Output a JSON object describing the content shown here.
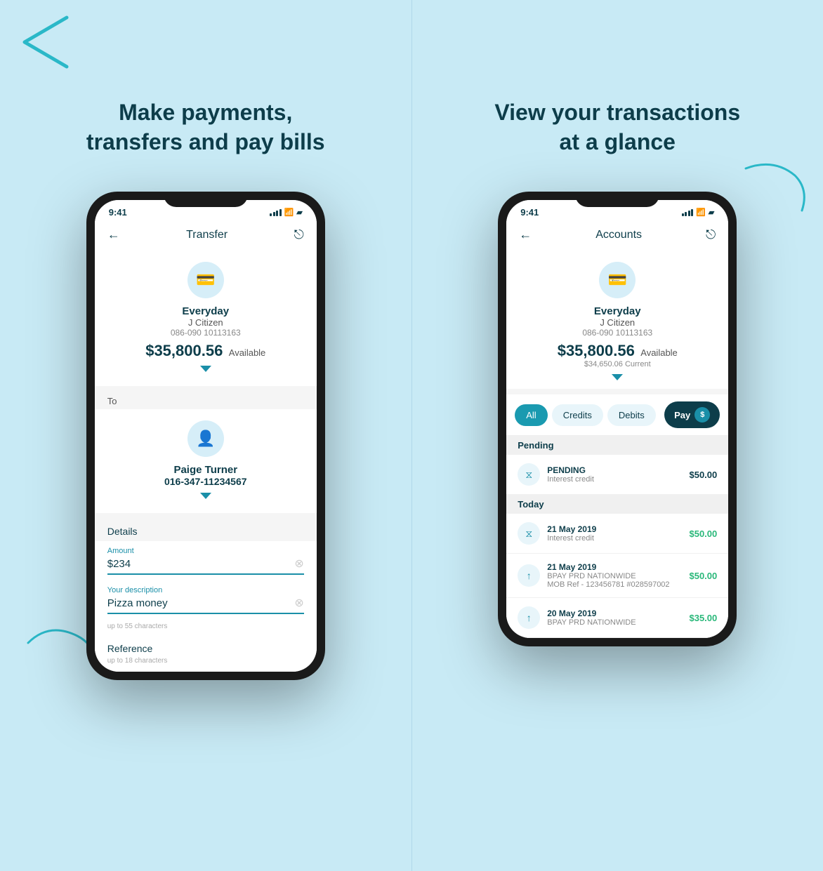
{
  "left_panel": {
    "heading": "Make payments, transfers and pay bills",
    "phone": {
      "status_time": "9:41",
      "app_title": "Transfer",
      "from_account": {
        "name": "Everyday",
        "holder": "J Citizen",
        "number": "086-090 10113163",
        "balance": "$35,800.56",
        "available_label": "Available"
      },
      "to_label": "To",
      "to_account": {
        "name": "Paige Turner",
        "number": "016-347-11234567"
      },
      "details_label": "Details",
      "amount_label": "Amount",
      "amount_value": "$234",
      "desc_label": "Your description",
      "desc_value": "Pizza money",
      "desc_hint": "up to 55 characters",
      "ref_label": "Reference",
      "ref_hint": "up to 18 characters"
    }
  },
  "right_panel": {
    "heading": "View your transactions at a glance",
    "phone": {
      "status_time": "9:41",
      "app_title": "Accounts",
      "account": {
        "name": "Everyday",
        "holder": "J Citizen",
        "number": "086-090 10113163",
        "balance": "$35,800.56",
        "available_label": "Available",
        "current_label": "$34,650.06 Current"
      },
      "tabs": {
        "all": "All",
        "credits": "Credits",
        "debits": "Debits",
        "pay": "Pay"
      },
      "pending_label": "Pending",
      "today_label": "Today",
      "transactions": [
        {
          "section": "pending",
          "status": "PENDING",
          "desc": "Interest credit",
          "amount": "$50.00",
          "amount_type": "dark"
        },
        {
          "section": "today",
          "date": "21 May 2019",
          "desc": "Interest credit",
          "amount": "$50.00",
          "amount_type": "green"
        },
        {
          "section": "today",
          "date": "21 May 2019",
          "desc": "BPAY PRD NATIONWIDE\nMOB Ref - 123456781 #028597002",
          "amount": "$50.00",
          "amount_type": "green"
        },
        {
          "section": "today",
          "date": "20 May 2019",
          "desc": "BPAY PRD NATIONWIDE",
          "amount": "$35.00",
          "amount_type": "green"
        }
      ]
    }
  }
}
